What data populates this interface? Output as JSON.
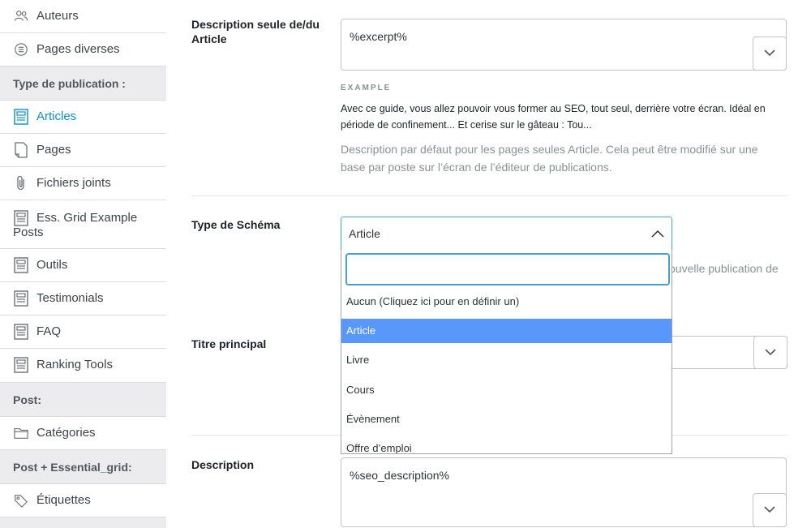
{
  "sidebar": {
    "items": [
      {
        "label": "Auteurs",
        "icon": "users-icon"
      },
      {
        "label": "Pages diverses",
        "icon": "list-circle-icon"
      },
      {
        "header": "Type de publication :"
      },
      {
        "label": "Articles",
        "icon": "document-icon",
        "active": true
      },
      {
        "label": "Pages",
        "icon": "page-icon"
      },
      {
        "label": "Fichiers joints",
        "icon": "paperclip-icon"
      },
      {
        "label": "Ess. Grid Example Posts",
        "icon": "document-icon"
      },
      {
        "label": "Outils",
        "icon": "document-icon"
      },
      {
        "label": "Testimonials",
        "icon": "document-icon"
      },
      {
        "label": "FAQ",
        "icon": "document-icon"
      },
      {
        "label": "Ranking Tools",
        "icon": "document-icon"
      },
      {
        "header": "Post:"
      },
      {
        "label": "Catégories",
        "icon": "folder-icon"
      },
      {
        "header": "Post + Essential_grid:"
      },
      {
        "label": "Étiquettes",
        "icon": "tag-icon"
      }
    ],
    "active_color": "#0a93c5"
  },
  "single_description": {
    "label": "Description seule de/du Article",
    "value": "%excerpt%",
    "example_caption": "EXAMPLE",
    "example_text": "Avec ce guide, vous allez pouvoir vous former au SEO, tout seul, derrière votre écran. Idéal en période de confinement... Et cerise sur le gâteau : Tou...",
    "help": "Description par défaut pour les pages seules Article. Cela peut être modifié sur une base par poste sur l’écran de l’éditeur de publications."
  },
  "schema_type": {
    "label": "Type de Schéma",
    "selected": "Article",
    "search_value": "",
    "options": [
      "Aucun (Cliquez ici pour en définir un)",
      "Article",
      "Livre",
      "Cours",
      "Évènement",
      "Offre d’emploi"
    ],
    "highlighted_index": 1,
    "help_partial": "ouvelle publication de"
  },
  "main_title": {
    "label": "Titre principal"
  },
  "description": {
    "label": "Description",
    "value": "%seo_description%"
  },
  "colors": {
    "highlight": "#5897fb",
    "focus_border": "#4a9ed6"
  }
}
